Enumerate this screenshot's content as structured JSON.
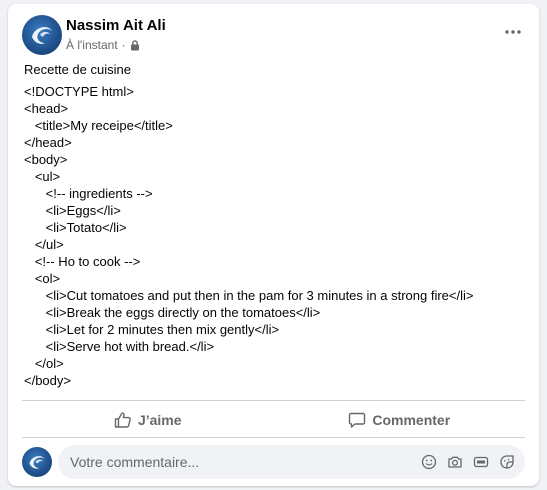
{
  "post": {
    "author": "Nassim Ait Ali",
    "timestamp": "À l'instant",
    "separator": "·",
    "privacy_icon": "lock-icon",
    "title": "Recette de cuisine",
    "code_lines": [
      "<!DOCTYPE html>",
      "<head>",
      "   <title>My receipe</title>",
      "</head>",
      "<body>",
      "   <ul>",
      "      <!-- ingredients -->",
      "      <li>Eggs</li>",
      "      <li>Totato</li>",
      "   </ul>",
      "   <!-- Ho to cook -->",
      "   <ol>",
      "      <li>Cut tomatoes and put then in the pam for 3 minutes in a strong fire</li>",
      "      <li>Break the eggs directly on the tomatoes</li>",
      "      <li>Let for 2 minutes then mix gently</li>",
      "      <li>Serve hot with bread.</li>",
      "   </ol>",
      "</body>"
    ]
  },
  "actions": {
    "like_label": "J’aime",
    "comment_label": "Commenter"
  },
  "comment": {
    "placeholder": "Votre commentaire...",
    "icons": [
      "smiley-icon",
      "camera-icon",
      "gif-icon",
      "sticker-icon"
    ]
  },
  "colors": {
    "text_primary": "#050505",
    "text_secondary": "#65676b",
    "background": "#f0f2f5",
    "card": "#ffffff"
  }
}
